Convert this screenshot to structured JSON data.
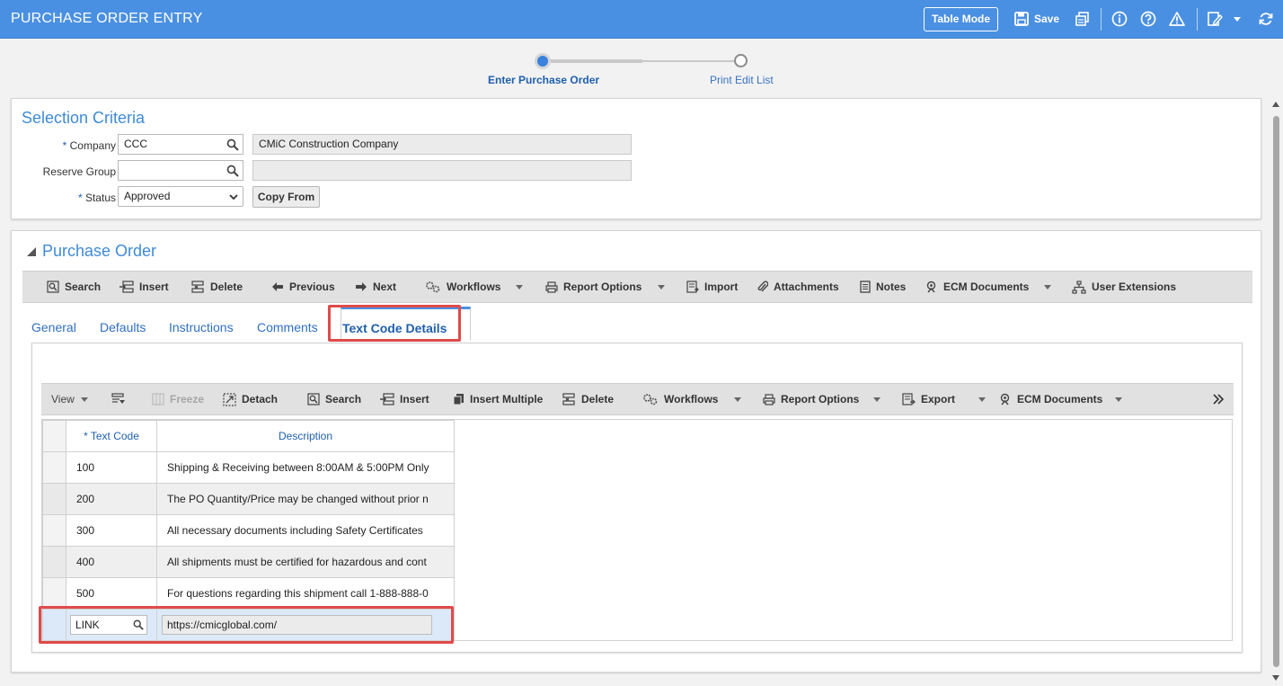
{
  "header": {
    "title": "PURCHASE ORDER ENTRY",
    "table_mode_label": "Table Mode",
    "save_label": "Save"
  },
  "train": {
    "steps": [
      {
        "label": "Enter Purchase Order",
        "state": "current"
      },
      {
        "label": "Print Edit List",
        "state": "pending"
      }
    ]
  },
  "selection": {
    "title": "Selection Criteria",
    "company": {
      "label": "Company",
      "value": "CCC",
      "name": "CMiC Construction Company"
    },
    "reserve_group": {
      "label": "Reserve Group",
      "value": "",
      "name": ""
    },
    "status": {
      "label": "Status",
      "value": "Approved"
    },
    "copy_from_label": "Copy From",
    "required_mark": "*"
  },
  "po": {
    "title": "Purchase Order",
    "toolbar": {
      "search": "Search",
      "insert": "Insert",
      "delete": "Delete",
      "previous": "Previous",
      "next": "Next",
      "workflows": "Workflows",
      "report_options": "Report Options",
      "import": "Import",
      "attachments": "Attachments",
      "notes": "Notes",
      "ecm_documents": "ECM Documents",
      "user_extensions": "User Extensions"
    },
    "tabs": [
      "General",
      "Defaults",
      "Instructions",
      "Comments",
      "Text Code Details"
    ],
    "active_tab": "Text Code Details",
    "grid_toolbar": {
      "view": "View",
      "freeze": "Freeze",
      "detach": "Detach",
      "search": "Search",
      "insert": "Insert",
      "insert_multiple": "Insert Multiple",
      "delete": "Delete",
      "workflows": "Workflows",
      "report_options": "Report Options",
      "export": "Export",
      "ecm_documents": "ECM Documents"
    },
    "grid": {
      "columns": {
        "text_code": "Text Code",
        "description": "Description"
      },
      "rows": [
        {
          "code": "100",
          "description": "Shipping & Receiving between 8:00AM & 5:00PM Only"
        },
        {
          "code": "200",
          "description": "The PO Quantity/Price may be changed without prior n"
        },
        {
          "code": "300",
          "description": "All necessary documents including Safety Certificates"
        },
        {
          "code": "400",
          "description": "All shipments must be certified for hazardous and cont"
        },
        {
          "code": "500",
          "description": "For questions regarding this shipment call 1-888-888-0"
        }
      ],
      "new_row": {
        "code": "LINK",
        "description": "https://cmicglobal.com/"
      }
    }
  },
  "colors": {
    "header_bg": "#4a90e2",
    "accent": "#3f8ad8",
    "highlight": "#e04a4a"
  }
}
